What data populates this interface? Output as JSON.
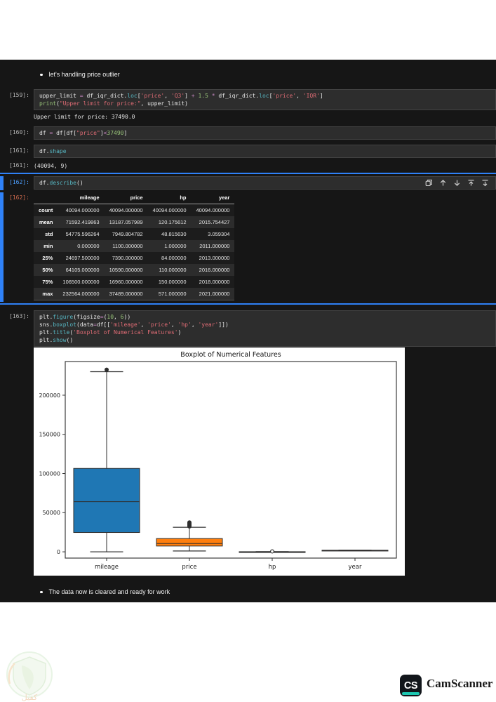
{
  "notebook": {
    "bullet_top": "let's handling price outlier",
    "bullet_bottom": "The data now is cleared and ready for work",
    "cells": {
      "c159": {
        "prompt": "[159]:",
        "lines": [
          [
            [
              "upper_limit ",
              "d"
            ],
            [
              "= ",
              "o"
            ],
            [
              "df_iqr_dict",
              "d"
            ],
            [
              ".",
              "d"
            ],
            [
              "loc",
              "m"
            ],
            [
              "[",
              "d"
            ],
            [
              "'price'",
              "s"
            ],
            [
              ", ",
              "d"
            ],
            [
              "'Q3'",
              "s"
            ],
            [
              "] ",
              "d"
            ],
            [
              "+ ",
              "o"
            ],
            [
              "1.5 ",
              "n"
            ],
            [
              "* ",
              "o"
            ],
            [
              "df_iqr_dict",
              "d"
            ],
            [
              ".",
              "d"
            ],
            [
              "loc",
              "m"
            ],
            [
              "[",
              "d"
            ],
            [
              "'price'",
              "s"
            ],
            [
              ", ",
              "d"
            ],
            [
              "'IQR'",
              "s"
            ],
            [
              "]",
              "d"
            ]
          ],
          [
            [
              "print",
              "b"
            ],
            [
              "(",
              "d"
            ],
            [
              "\"Upper limit for price:\"",
              "s"
            ],
            [
              ", ",
              "d"
            ],
            [
              "upper_limit",
              "d"
            ],
            [
              ")",
              "d"
            ]
          ]
        ]
      },
      "c160": {
        "prompt": "[160]:",
        "lines": [
          [
            [
              "df ",
              "d"
            ],
            [
              "= ",
              "o"
            ],
            [
              "df[df[",
              "d"
            ],
            [
              "\"price\"",
              "s"
            ],
            [
              "]",
              "d"
            ],
            [
              "<",
              "o"
            ],
            [
              "37490",
              "n"
            ],
            [
              "]",
              "d"
            ]
          ]
        ]
      },
      "c161": {
        "prompt": "[161]:",
        "lines": [
          [
            [
              "df",
              "d"
            ],
            [
              ".",
              "d"
            ],
            [
              "shape",
              "m"
            ]
          ]
        ]
      },
      "c162": {
        "prompt": "[162]:",
        "lines": [
          [
            [
              "df",
              "d"
            ],
            [
              ".",
              "d"
            ],
            [
              "describe",
              "m"
            ],
            [
              "()",
              "d"
            ]
          ]
        ]
      },
      "c163": {
        "prompt": "[163]:",
        "lines": [
          [
            [
              "plt",
              "d"
            ],
            [
              ".",
              "d"
            ],
            [
              "figure",
              "m"
            ],
            [
              "(",
              "d"
            ],
            [
              "figsize",
              "d"
            ],
            [
              "=",
              "o"
            ],
            [
              "(",
              "d"
            ],
            [
              "10",
              "n"
            ],
            [
              ", ",
              "d"
            ],
            [
              "6",
              "n"
            ],
            [
              "))",
              "d"
            ]
          ],
          [
            [
              "sns",
              "d"
            ],
            [
              ".",
              "d"
            ],
            [
              "boxplot",
              "m"
            ],
            [
              "(",
              "d"
            ],
            [
              "data",
              "d"
            ],
            [
              "=",
              "o"
            ],
            [
              "df[[",
              "d"
            ],
            [
              "'mileage'",
              "s"
            ],
            [
              ", ",
              "d"
            ],
            [
              "'price'",
              "s"
            ],
            [
              ", ",
              "d"
            ],
            [
              "'hp'",
              "s"
            ],
            [
              ", ",
              "d"
            ],
            [
              "'year'",
              "s"
            ],
            [
              "]])",
              "d"
            ]
          ],
          [
            [
              "plt",
              "d"
            ],
            [
              ".",
              "d"
            ],
            [
              "title",
              "m"
            ],
            [
              "(",
              "d"
            ],
            [
              "'Boxplot of Numerical Features'",
              "s"
            ],
            [
              ")",
              "d"
            ]
          ],
          [
            [
              "plt",
              "d"
            ],
            [
              ".",
              "d"
            ],
            [
              "show",
              "m"
            ],
            [
              "()",
              "d"
            ]
          ]
        ]
      }
    },
    "outputs": {
      "o159": {
        "prompt": "",
        "text": "Upper limit for price: 37490.0"
      },
      "o161": {
        "prompt": "[161]:",
        "text": "(40094, 9)"
      },
      "o162_prompt": "[162]:"
    }
  },
  "toolbar": {
    "icons": [
      "duplicate-cell",
      "move-cell-up",
      "move-cell-down",
      "insert-cell-above",
      "insert-cell-below"
    ]
  },
  "describe_table": {
    "columns": [
      "mileage",
      "price",
      "hp",
      "year"
    ],
    "rows": [
      {
        "label": "count",
        "values": [
          "40094.000000",
          "40094.000000",
          "40094.000000",
          "40094.000000"
        ]
      },
      {
        "label": "mean",
        "values": [
          "71592.419863",
          "13187.057989",
          "120.175612",
          "2015.754427"
        ]
      },
      {
        "label": "std",
        "values": [
          "54775.596264",
          "7949.804782",
          "48.815630",
          "3.059304"
        ]
      },
      {
        "label": "min",
        "values": [
          "0.000000",
          "1100.000000",
          "1.000000",
          "2011.000000"
        ]
      },
      {
        "label": "25%",
        "values": [
          "24697.500000",
          "7390.000000",
          "84.000000",
          "2013.000000"
        ]
      },
      {
        "label": "50%",
        "values": [
          "64105.000000",
          "10590.000000",
          "110.000000",
          "2016.000000"
        ]
      },
      {
        "label": "75%",
        "values": [
          "106500.000000",
          "16960.000000",
          "150.000000",
          "2018.000000"
        ]
      },
      {
        "label": "max",
        "values": [
          "232564.000000",
          "37489.000000",
          "571.000000",
          "2021.000000"
        ]
      }
    ]
  },
  "chart_data": {
    "type": "boxplot",
    "title": "Boxplot of Numerical Features",
    "categories": [
      "mileage",
      "price",
      "hp",
      "year"
    ],
    "ylim": [
      -8000,
      243000
    ],
    "yticks": [
      0,
      50000,
      100000,
      150000,
      200000
    ],
    "grid": false,
    "series": [
      {
        "name": "mileage",
        "whisker_low": 0,
        "q1": 24697.5,
        "median": 64105,
        "q3": 106500,
        "whisker_high": 230000,
        "outliers": [
          232564
        ],
        "color": "#1f77b4"
      },
      {
        "name": "price",
        "whisker_low": 1100,
        "q1": 7390,
        "median": 10590,
        "q3": 16960,
        "whisker_high": 31315,
        "outliers": [
          32500,
          33800,
          35000,
          36200,
          37489
        ],
        "color": "#ff7f0e"
      },
      {
        "name": "hp",
        "whisker_low": 1,
        "q1": 84,
        "median": 110,
        "q3": 150,
        "whisker_high": 249,
        "outliers": [
          571
        ],
        "color": "#2ca02c",
        "open_fliers": true
      },
      {
        "name": "year",
        "whisker_low": 2011,
        "q1": 2013,
        "median": 2016,
        "q3": 2018,
        "whisker_high": 2021,
        "outliers": [],
        "color": "#d62728"
      }
    ]
  },
  "footer": {
    "camscanner_badge": "CS",
    "camscanner_text": "CamScanner",
    "watermark_text": "كفيل"
  },
  "colors": {
    "notebook_bg": "#161616",
    "cell_bg": "#2d2d2d",
    "selection_blue": "#2f81f7",
    "prompt_in_active": "#4d9fff",
    "prompt_out_active": "#cf6a4d",
    "string": "#e06c75",
    "number": "#98c379",
    "method": "#56b6c2",
    "operator": "#c586c0",
    "box_blue": "#1f77b4",
    "box_orange": "#ff7f0e",
    "camscanner_teal": "#1ec8b2"
  }
}
